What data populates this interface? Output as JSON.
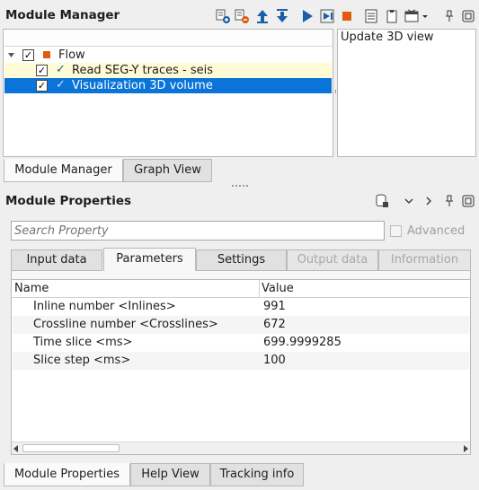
{
  "module_manager": {
    "title": "Module Manager",
    "tree": {
      "root_label": "Flow",
      "items": [
        {
          "label": "Read SEG-Y traces - seis",
          "checked": true
        },
        {
          "label": "Visualization 3D volume",
          "checked": true
        }
      ]
    },
    "side_text": "Update 3D view",
    "tabs": [
      "Module Manager",
      "Graph View"
    ]
  },
  "module_properties": {
    "title": "Module Properties",
    "search_placeholder": "Search Property",
    "advanced_label": "Advanced",
    "tabs": [
      "Input data",
      "Parameters",
      "Settings",
      "Output data",
      "Information"
    ],
    "columns": [
      "Name",
      "Value"
    ],
    "rows": [
      {
        "name": "Inline number <Inlines>",
        "value": "991"
      },
      {
        "name": "Crossline number <Crosslines>",
        "value": "672"
      },
      {
        "name": "Time slice <ms>",
        "value": "699.9999285"
      },
      {
        "name": "Slice step <ms>",
        "value": "100"
      }
    ]
  },
  "bottom_tabs": [
    "Module Properties",
    "Help View",
    "Tracking info"
  ],
  "colors": {
    "selection": "#0a74d8",
    "highlight_row": "#fffbd6",
    "accent_orange": "#e05a10",
    "accent_blue": "#1b5fa6"
  }
}
